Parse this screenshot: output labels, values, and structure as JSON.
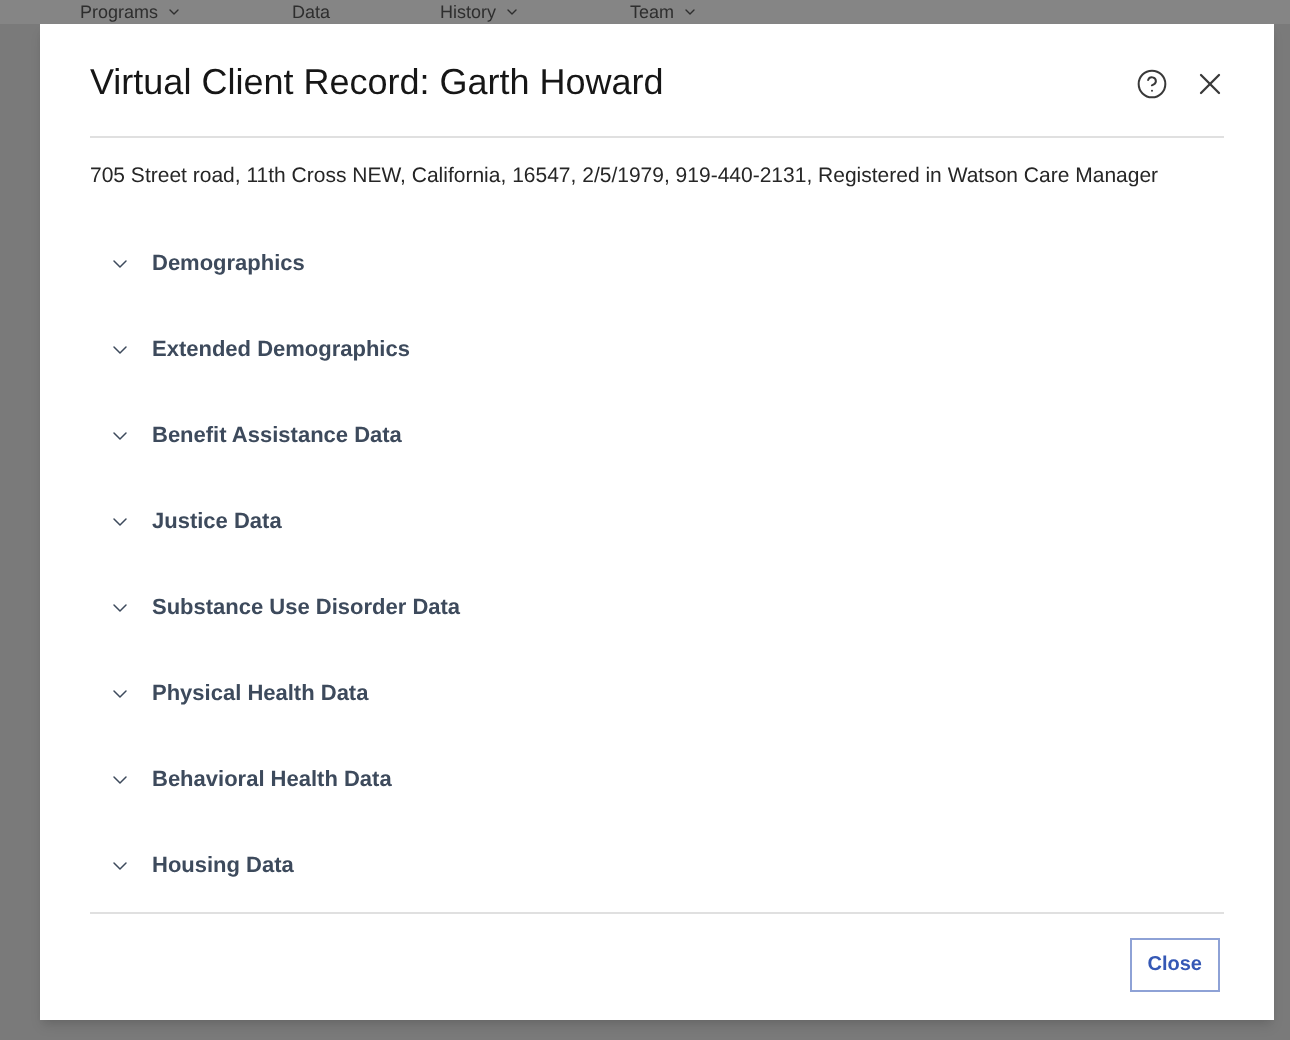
{
  "nav": [
    {
      "label": "Programs",
      "caret": true
    },
    {
      "label": "Data",
      "caret": false
    },
    {
      "label": "History",
      "caret": true
    },
    {
      "label": "Team",
      "caret": true
    }
  ],
  "dialog": {
    "title": "Virtual Client Record: Garth Howard",
    "summary": "705 Street road, 11th Cross NEW, California, 16547, 2/5/1979, 919-440-2131, Registered in Watson Care Manager",
    "sections": [
      {
        "label": "Demographics",
        "expanded": false
      },
      {
        "label": "Extended Demographics",
        "expanded": false
      },
      {
        "label": "Benefit Assistance Data",
        "expanded": false
      },
      {
        "label": "Justice Data",
        "expanded": false
      },
      {
        "label": "Substance Use Disorder Data",
        "expanded": false
      },
      {
        "label": "Physical Health Data",
        "expanded": false
      },
      {
        "label": "Behavioral Health Data",
        "expanded": false
      },
      {
        "label": "Housing Data",
        "expanded": false
      }
    ],
    "close_button": "Close"
  }
}
